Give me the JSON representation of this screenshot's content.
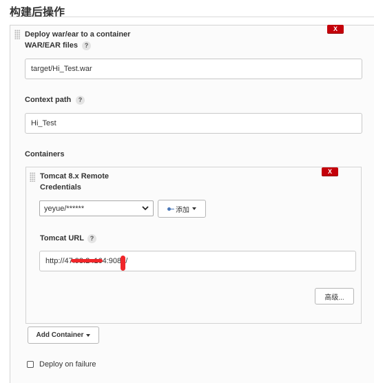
{
  "section": {
    "title": "构建后操作"
  },
  "deploy": {
    "title": "Deploy war/ear to a container",
    "delete_label": "X",
    "war_files": {
      "label": "WAR/EAR files",
      "help": "?",
      "value": "target/Hi_Test.war"
    },
    "context_path": {
      "label": "Context path",
      "help": "?",
      "value": "Hi_Test"
    },
    "containers_label": "Containers",
    "container": {
      "title": "Tomcat 8.x Remote",
      "delete_label": "X",
      "credentials_label": "Credentials",
      "credentials_selected": "yeyue/******",
      "add_button": "添加",
      "url": {
        "label": "Tomcat URL",
        "help": "?",
        "value": "http://47.93.2  .164:9080/"
      },
      "advanced_button": "高级..."
    },
    "add_container_button": "Add Container",
    "deploy_on_failure_label": "Deploy on failure"
  },
  "colors": {
    "delete": "#c4000a",
    "redaction": "#f0262a"
  },
  "icons": {
    "add_button_icon": "key-icon",
    "select_arrow": "chevron-down-icon"
  }
}
